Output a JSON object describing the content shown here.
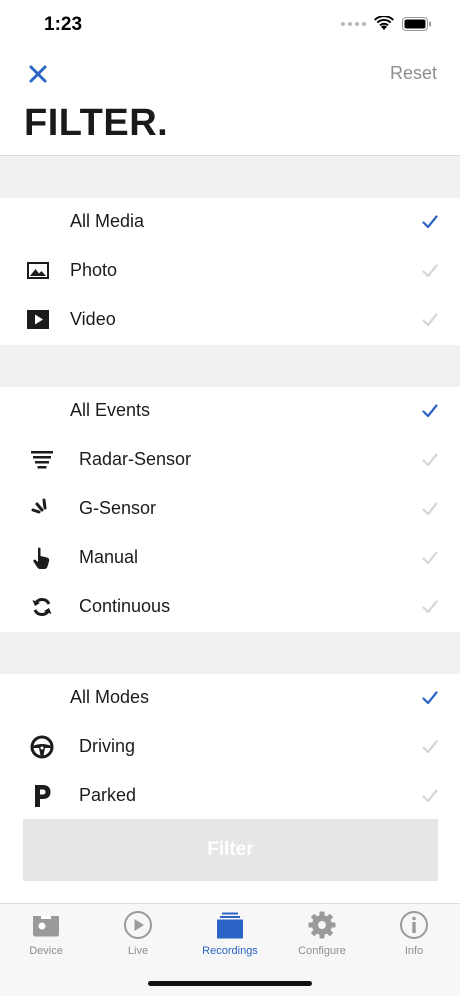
{
  "status": {
    "time": "1:23"
  },
  "nav": {
    "reset_label": "Reset"
  },
  "title": "FILTER.",
  "colors": {
    "accent": "#2a64c4",
    "check_inactive": "#d6d6d6",
    "section_gap": "#f1f1f1"
  },
  "media": {
    "items": [
      {
        "label": "All Media",
        "icon": "",
        "checked": true
      },
      {
        "label": "Photo",
        "icon": "photo-icon",
        "checked": false
      },
      {
        "label": "Video",
        "icon": "video-icon",
        "checked": false
      }
    ]
  },
  "events": {
    "items": [
      {
        "label": "All Events",
        "icon": "",
        "checked": true
      },
      {
        "label": "Radar-Sensor",
        "icon": "radar-sensor-icon",
        "checked": false
      },
      {
        "label": "G-Sensor",
        "icon": "g-sensor-icon",
        "checked": false
      },
      {
        "label": "Manual",
        "icon": "hand-pointer-icon",
        "checked": false
      },
      {
        "label": "Continuous",
        "icon": "sync-icon",
        "checked": false
      }
    ]
  },
  "modes": {
    "items": [
      {
        "label": "All Modes",
        "icon": "",
        "checked": true
      },
      {
        "label": "Driving",
        "icon": "steering-wheel-icon",
        "checked": false
      },
      {
        "label": "Parked",
        "icon": "parking-icon",
        "checked": false
      }
    ]
  },
  "filter_button": {
    "label": "Filter"
  },
  "tabs": [
    {
      "label": "Device",
      "icon": "device-icon",
      "active": false
    },
    {
      "label": "Live",
      "icon": "play-icon",
      "active": false
    },
    {
      "label": "Recordings",
      "icon": "recordings-icon",
      "active": true
    },
    {
      "label": "Configure",
      "icon": "gear-icon",
      "active": false
    },
    {
      "label": "Info",
      "icon": "info-icon",
      "active": false
    }
  ]
}
